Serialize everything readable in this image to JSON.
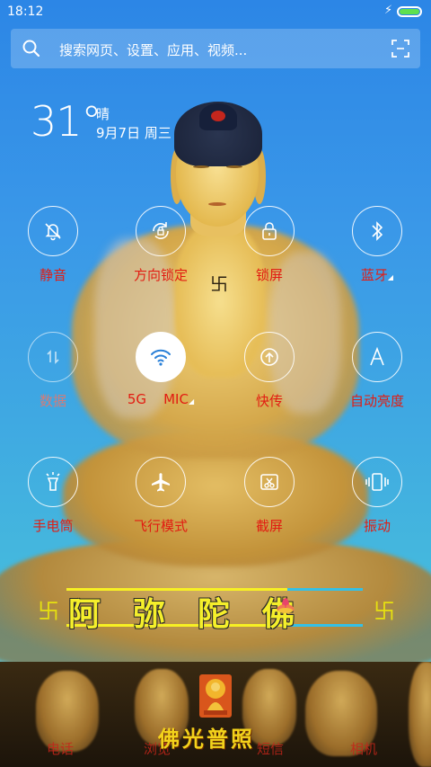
{
  "status_bar": {
    "time": "18:12",
    "battery_color": "#5ee04f"
  },
  "search": {
    "placeholder": "搜索网页、设置、应用、视频..."
  },
  "weather": {
    "temperature": "31°",
    "condition": "晴",
    "date": "9月7日 周三"
  },
  "toggles": [
    {
      "label": "静音",
      "icon": "bell-off-icon",
      "active": false
    },
    {
      "label": "方向锁定",
      "icon": "rotation-lock-icon",
      "active": false
    },
    {
      "label": "锁屏",
      "icon": "lock-icon",
      "active": false
    },
    {
      "label": "蓝牙",
      "icon": "bluetooth-icon",
      "active": false
    },
    {
      "label": "数据",
      "icon": "mobile-data-icon",
      "active": false
    },
    {
      "label": "5G    MIC",
      "icon": "wifi-icon",
      "active": true
    },
    {
      "label": "快传",
      "icon": "quick-transfer-icon",
      "active": false
    },
    {
      "label": "自动亮度",
      "icon": "auto-brightness-icon",
      "active": false
    },
    {
      "label": "手电筒",
      "icon": "flashlight-icon",
      "active": false
    },
    {
      "label": "飞行模式",
      "icon": "airplane-icon",
      "active": false
    },
    {
      "label": "截屏",
      "icon": "screenshot-icon",
      "active": false
    },
    {
      "label": "振动",
      "icon": "vibrate-icon",
      "active": false
    }
  ],
  "banner": {
    "text": "阿弥陀佛",
    "left_symbol": "卐",
    "right_symbol": "卐"
  },
  "dock": {
    "apps": [
      "电话",
      "浏览",
      "短信",
      "相机"
    ],
    "center_title": "佛光普照"
  },
  "colors": {
    "label_red": "#e21c12",
    "banner_yellow": "#f5ef2b",
    "accent_cyan": "#34c0e6"
  }
}
